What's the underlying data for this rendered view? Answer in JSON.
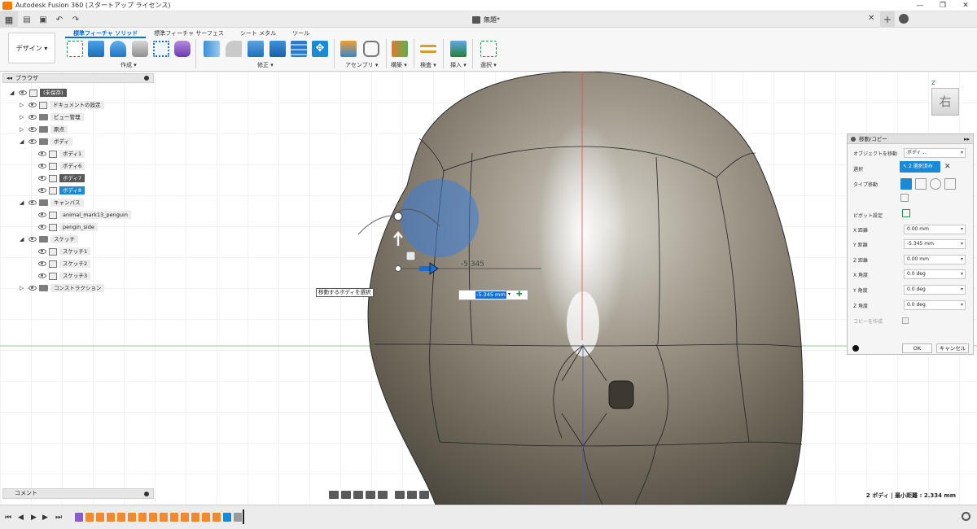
{
  "window": {
    "title": "Autodesk Fusion 360 (スタートアップ ライセンス)",
    "document_tab": "無題*"
  },
  "toolbar": {
    "workspace": "デザイン ▾",
    "tabs": [
      "ソリッド",
      "サーフェス",
      "シート メタル",
      "ツール"
    ],
    "active_tab_index": 0,
    "tab_prefix": "標準フィーチャ ",
    "groups": [
      "作成 ▾",
      "修正 ▾",
      "アセンブリ ▾",
      "構築 ▾",
      "検査 ▾",
      "挿入 ▾",
      "選択 ▾"
    ]
  },
  "browser": {
    "title": "ブラウザ",
    "items": [
      {
        "label": "(未保存)",
        "style": "dark"
      },
      {
        "label": "ドキュメントの設定",
        "style": "plain"
      },
      {
        "label": "ビュー管理",
        "style": "plain"
      },
      {
        "label": "原点",
        "style": "plain"
      },
      {
        "label": "ボディ",
        "style": "plain"
      },
      {
        "label": "ボディ1",
        "style": "plain"
      },
      {
        "label": "ボディ6",
        "style": "plain"
      },
      {
        "label": "ボディ7",
        "style": "dark"
      },
      {
        "label": "ボディ8",
        "style": "blue"
      },
      {
        "label": "キャンバス",
        "style": "plain"
      },
      {
        "label": "animal_mark13_penguin",
        "style": "plain"
      },
      {
        "label": "pengin_side",
        "style": "plain"
      },
      {
        "label": "スケッチ",
        "style": "plain"
      },
      {
        "label": "スケッチ1",
        "style": "plain"
      },
      {
        "label": "スケッチ2",
        "style": "plain"
      },
      {
        "label": "スケッチ3",
        "style": "plain"
      },
      {
        "label": "コンストラクション",
        "style": "plain"
      }
    ]
  },
  "comment": {
    "label": "コメント"
  },
  "viewport": {
    "tooltip": "移動するボディを選択",
    "distance_label": "-5.345",
    "value_input": "-5.345 mm",
    "view_cube_face": "右",
    "view_cube_axis": "Z"
  },
  "dialog": {
    "title": "移動/コピー",
    "rows": [
      {
        "label": "オブジェクトを移動",
        "value": "ボディ..."
      },
      {
        "label": "選択",
        "value": "2 選択済み"
      },
      {
        "label": "タイプ移動",
        "value": ""
      },
      {
        "label": "ピボット設定",
        "value": ""
      },
      {
        "label": "X 距離",
        "value": "0.00 mm"
      },
      {
        "label": "Y 距離",
        "value": "-5.345 mm"
      },
      {
        "label": "Z 距離",
        "value": "0.00 mm"
      },
      {
        "label": "X 角度",
        "value": "0.0 deg"
      },
      {
        "label": "Y 角度",
        "value": "0.0 deg"
      },
      {
        "label": "Z 角度",
        "value": "0.0 deg"
      },
      {
        "label": "コピーを作成",
        "value": ""
      }
    ],
    "ok": "OK",
    "cancel": "キャンセル"
  },
  "status": {
    "right_text": "2 ボディ | 最小距離 : 2.334 mm"
  },
  "colors": {
    "accent": "#1a8ad6",
    "body_shade": "#8b8272",
    "gizmo_blue": "#3b7dd8"
  }
}
